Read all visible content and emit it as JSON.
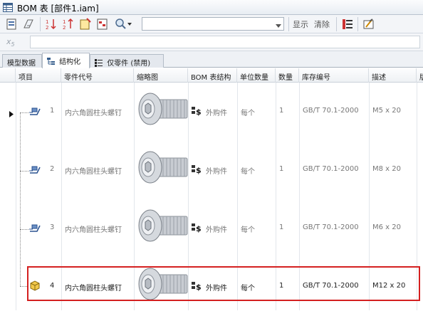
{
  "window": {
    "title": "BOM 表 [部件1.iam]"
  },
  "toolbar": {
    "combo_value": "",
    "show_label": "显示",
    "clear_label": "清除"
  },
  "tabs": [
    {
      "label": "模型数据"
    },
    {
      "label": "结构化"
    },
    {
      "label": "仅零件 (禁用)"
    }
  ],
  "active_tab": 1,
  "columns": [
    "项目",
    "零件代号",
    "缩略图",
    "BOM 表结构",
    "单位数量",
    "数量",
    "库存编号",
    "描述",
    "版"
  ],
  "rows": [
    {
      "item": "1",
      "part": "内六角圆柱头螺钉",
      "bom": "外购件",
      "unit": "每个",
      "qty": "1",
      "stock": "GB/T 70.1-2000",
      "desc": "M5 x 20"
    },
    {
      "item": "2",
      "part": "内六角圆柱头螺钉",
      "bom": "外购件",
      "unit": "每个",
      "qty": "1",
      "stock": "GB/T 70.1-2000",
      "desc": "M8 x 20"
    },
    {
      "item": "3",
      "part": "内六角圆柱头螺钉",
      "bom": "外购件",
      "unit": "每个",
      "qty": "1",
      "stock": "GB/T 70.1-2000",
      "desc": "M6 x 20"
    },
    {
      "item": "4",
      "part": "内六角圆柱头螺钉",
      "bom": "外购件",
      "unit": "每个",
      "qty": "1",
      "stock": "GB/T 70.1-2000",
      "desc": "M12 x 20"
    }
  ],
  "selected_row": 4,
  "icons": {
    "app": "table-icon",
    "part_row": "assembly-part-icon",
    "part_selected": "yellow-cube-icon",
    "bom_structure": "purchased-part-icon",
    "thumbnail": "socket-head-cap-screw-thumbnail"
  },
  "colors": {
    "highlight_frame": "#d42020",
    "tab_border": "#b3bcc7"
  }
}
